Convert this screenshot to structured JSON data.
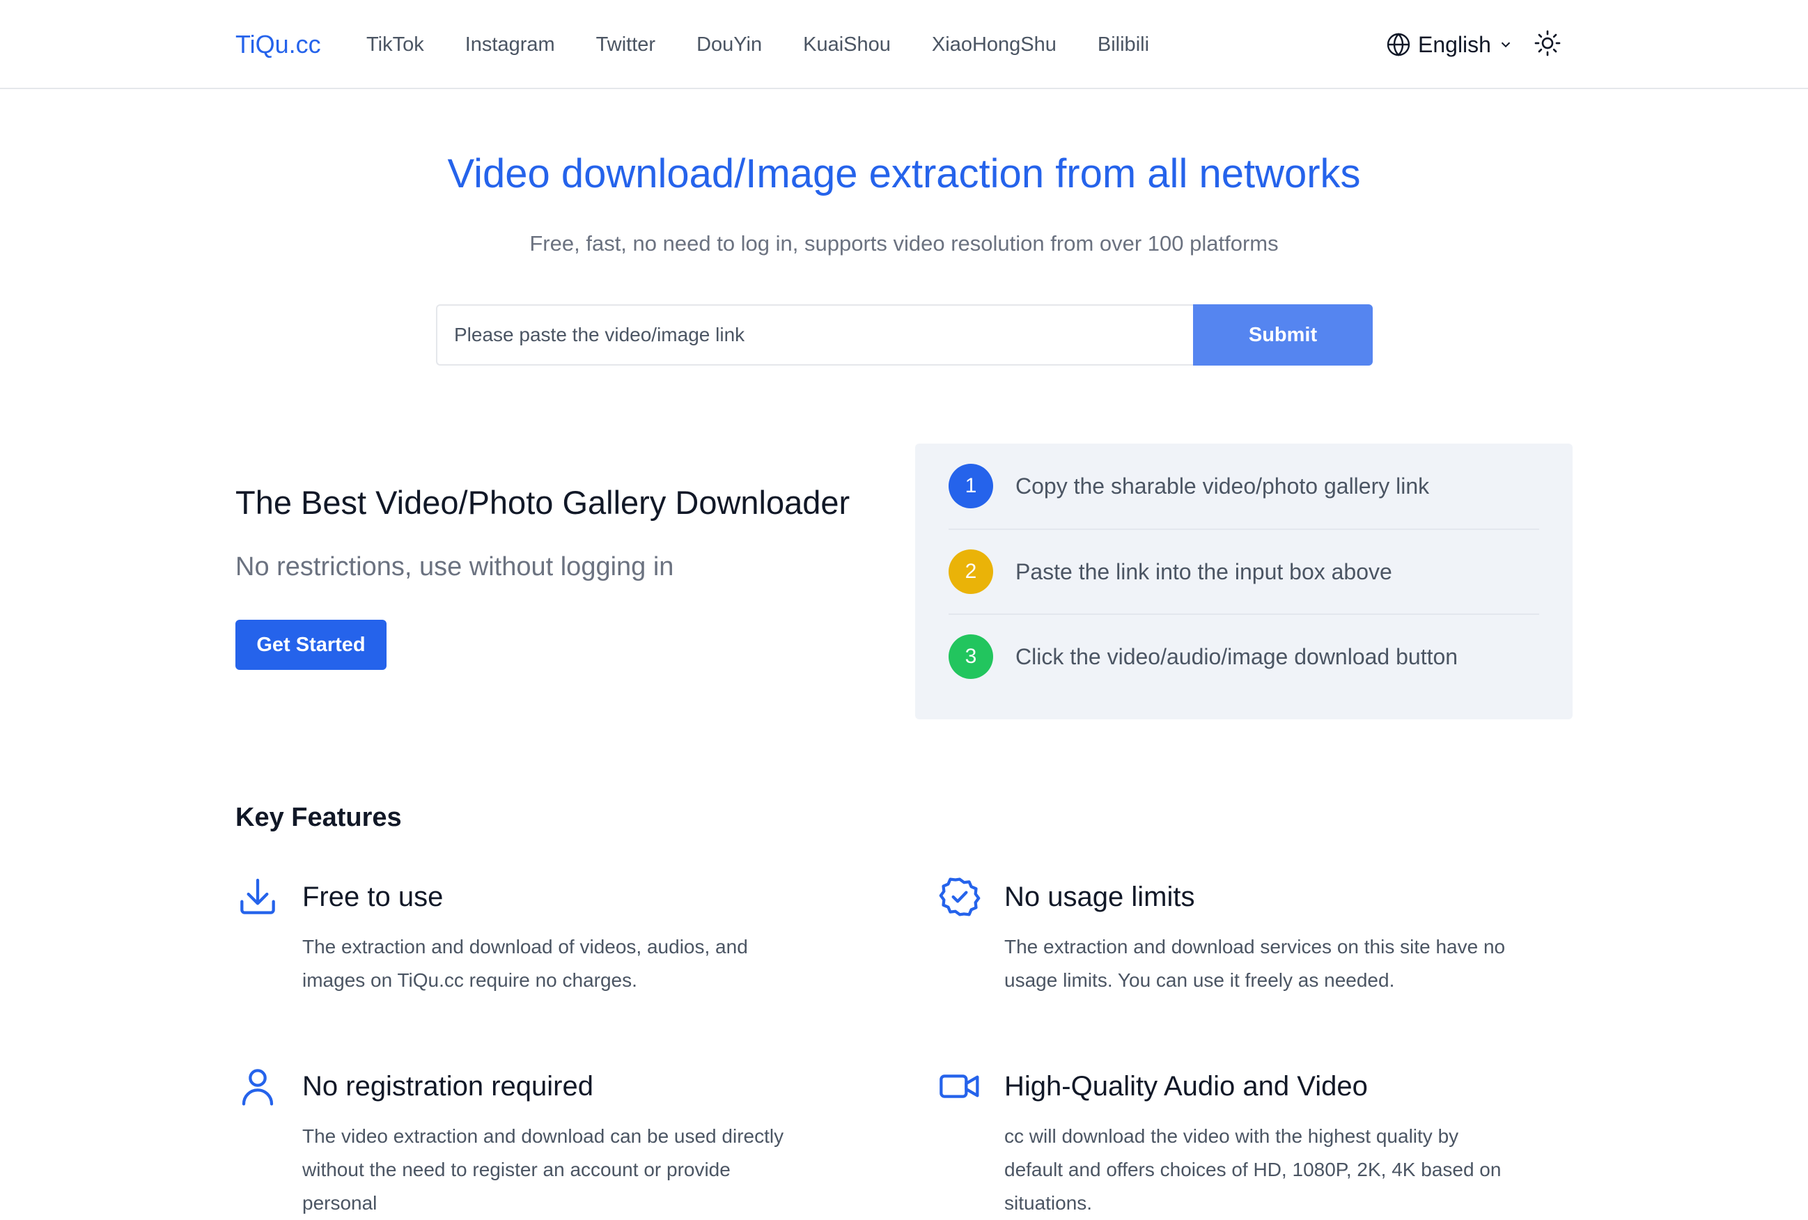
{
  "header": {
    "logo": "TiQu.cc",
    "nav": [
      "TikTok",
      "Instagram",
      "Twitter",
      "DouYin",
      "KuaiShou",
      "XiaoHongShu",
      "Bilibili"
    ],
    "language": "English",
    "language_icon": "globe-icon",
    "theme_icon": "sun-icon"
  },
  "hero": {
    "title": "Video download/Image extraction from all networks",
    "subtitle": "Free, fast, no need to log in, supports video resolution from over 100 platforms",
    "input_placeholder": "Please paste the video/image link",
    "input_value": "",
    "submit_label": "Submit"
  },
  "promo": {
    "title": "The Best Video/Photo Gallery Downloader",
    "subtitle": "No restrictions, use without logging in",
    "cta_label": "Get Started"
  },
  "steps": [
    {
      "number": "1",
      "text": "Copy the sharable video/photo gallery link",
      "color": "#2563eb"
    },
    {
      "number": "2",
      "text": "Paste the link into the input box above",
      "color": "#eab308"
    },
    {
      "number": "3",
      "text": "Click the video/audio/image download button",
      "color": "#22c55e"
    }
  ],
  "features": {
    "title": "Key Features",
    "items": [
      {
        "icon": "download-icon",
        "title": "Free to use",
        "desc": "The extraction and download of videos, audios, and images on TiQu.cc require no charges."
      },
      {
        "icon": "badge-check-icon",
        "title": "No usage limits",
        "desc": "The extraction and download services on this site have no usage limits. You can use it freely as needed."
      },
      {
        "icon": "user-icon",
        "title": "No registration required",
        "desc": "The video extraction and download can be used directly without the need to register an account or provide personal"
      },
      {
        "icon": "video-camera-icon",
        "title": "High-Quality Audio and Video",
        "desc": "cc will download the video with the highest quality by default and offers choices of HD, 1080P, 2K, 4K based on situations."
      }
    ]
  },
  "colors": {
    "brand": "#2563eb",
    "submit": "#5585f0",
    "card_bg": "#f0f3f8",
    "text_muted": "#6b7280"
  }
}
